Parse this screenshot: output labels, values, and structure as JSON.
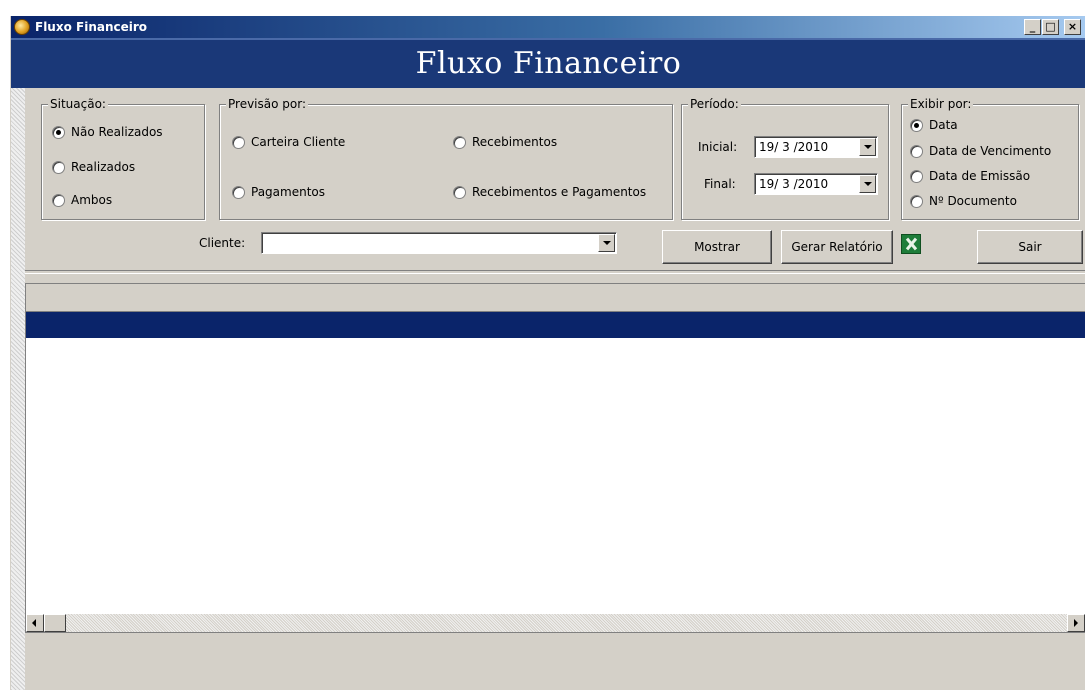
{
  "window": {
    "title": "Fluxo Financeiro",
    "buttons": {
      "minimize": "_",
      "maximize": "□",
      "close": "×"
    }
  },
  "banner": {
    "title": "Fluxo Financeiro"
  },
  "situacao": {
    "legend": "Situação:",
    "options": [
      "Não Realizados",
      "Realizados",
      "Ambos"
    ],
    "selected": "Não Realizados"
  },
  "previsao": {
    "legend": "Previsão por:",
    "options": [
      "Carteira Cliente",
      "Recebimentos",
      "Pagamentos",
      "Recebimentos e Pagamentos"
    ],
    "selected": ""
  },
  "periodo": {
    "legend": "Período:",
    "inicial_label": "Inicial:",
    "inicial_value": "19/ 3 /2010",
    "final_label": "Final:",
    "final_value": "19/ 3 /2010"
  },
  "exibir": {
    "legend": "Exibir por:",
    "options": [
      "Data",
      "Data de Vencimento",
      "Data de Emissão",
      "Nº Documento"
    ],
    "selected": "Data"
  },
  "cliente": {
    "label": "Cliente:",
    "value": ""
  },
  "actions": {
    "mostrar": "Mostrar",
    "gerar_relatorio": "Gerar Relatório",
    "sair": "Sair",
    "excel_icon": "excel-icon"
  },
  "colors": {
    "banner": "#1a3878",
    "selection": "#0a246a",
    "face": "#d4d0c8"
  }
}
